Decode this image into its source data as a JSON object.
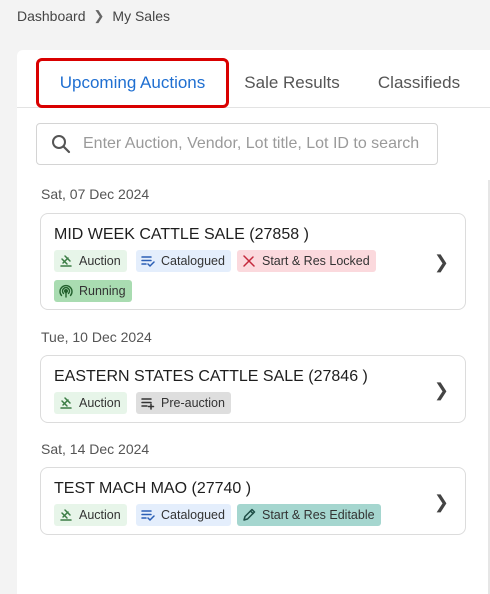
{
  "breadcrumb": {
    "home": "Dashboard",
    "current": "My Sales"
  },
  "tabs": [
    {
      "label": "Upcoming Auctions",
      "active": true
    },
    {
      "label": "Sale Results",
      "active": false
    },
    {
      "label": "Classifieds",
      "active": false
    }
  ],
  "search": {
    "placeholder": "Enter Auction, Vendor, Lot title, Lot ID to search",
    "value": ""
  },
  "groups": [
    {
      "date": "Sat, 07 Dec 2024",
      "title": "MID WEEK CATTLE SALE (27858 )",
      "badges": [
        "Auction",
        "Catalogued",
        "Start & Res Locked",
        "Running"
      ]
    },
    {
      "date": "Tue, 10 Dec 2024",
      "title": "EASTERN STATES CATTLE SALE (27846 )",
      "badges": [
        "Auction",
        "Pre-auction"
      ]
    },
    {
      "date": "Sat, 14 Dec 2024",
      "title": "TEST MACH MAO (27740 )",
      "badges": [
        "Auction",
        "Catalogued",
        "Start & Res Editable"
      ]
    }
  ],
  "colors": {
    "accent": "#1f6fd1",
    "highlight": "#d90000",
    "auction_badge": "#e7f5e9",
    "catalogued_badge": "#e4eefc",
    "locked_badge": "#fbd9dd",
    "running_badge": "#a9dcb1",
    "preauction_badge": "#dedede",
    "editable_badge": "#a5d6cf"
  },
  "icons": {
    "auction": "gavel-icon",
    "catalogued": "checklist-icon",
    "locked": "edit-off-icon",
    "running": "broadcast-icon",
    "preauction": "playlist-add-icon",
    "editable": "pencil-icon",
    "search": "search-icon",
    "chevron": "chevron-right-icon"
  }
}
